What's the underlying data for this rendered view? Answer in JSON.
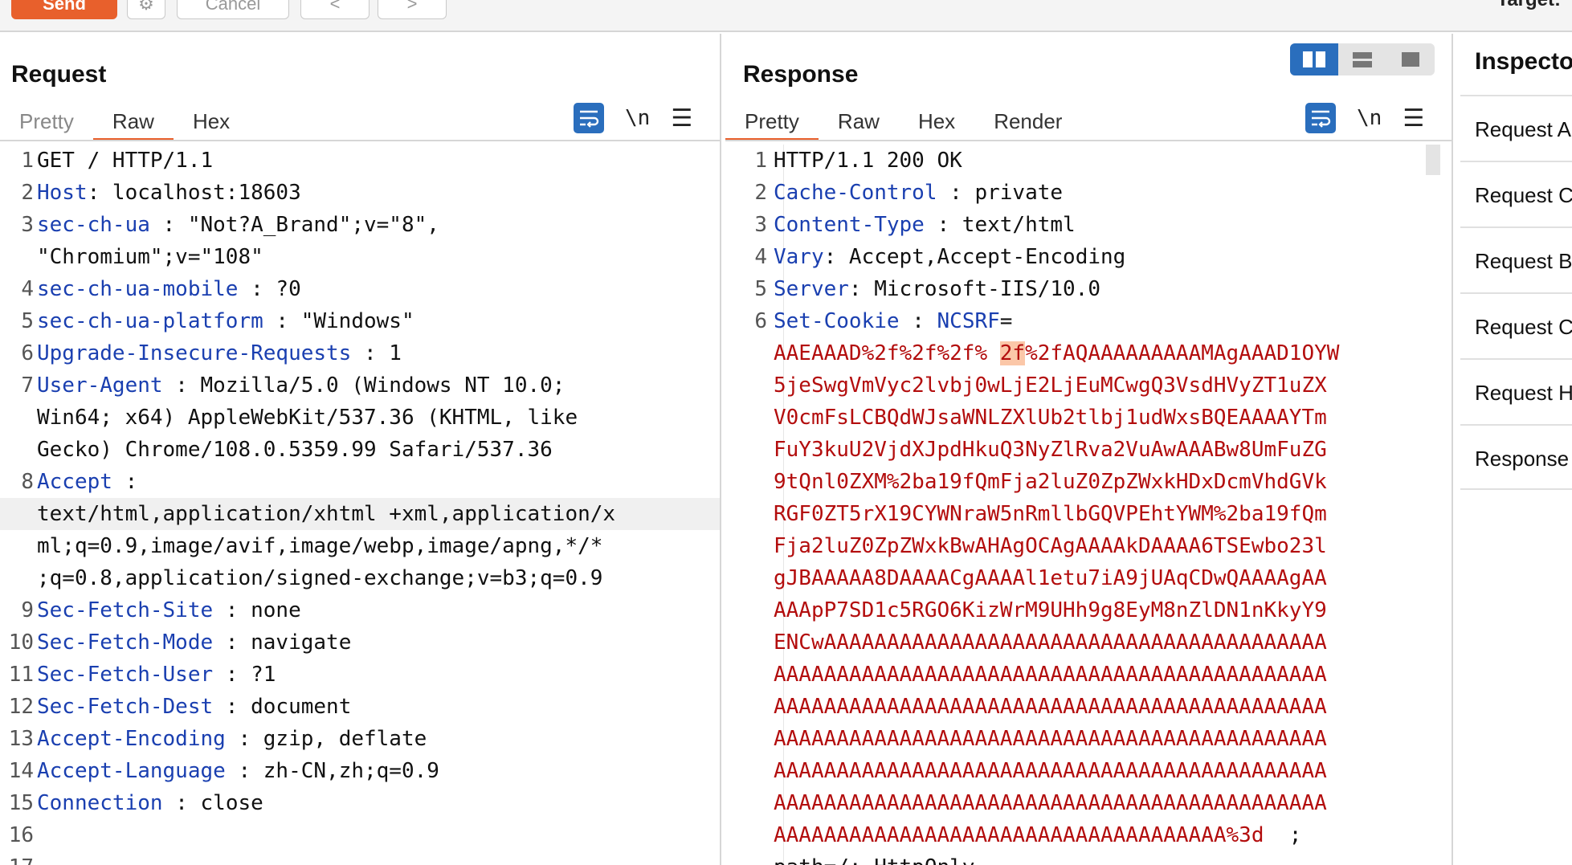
{
  "toolbar": {
    "send_label": "Send",
    "cancel_label": "Cancel",
    "back_label": "<",
    "forward_label": ">",
    "target_label": "Target:"
  },
  "request": {
    "title": "Request",
    "tabs": [
      "Pretty",
      "Raw",
      "Hex"
    ],
    "active_tab": "Raw"
  },
  "response": {
    "title": "Response",
    "tabs": [
      "Pretty",
      "Raw",
      "Hex",
      "Render"
    ],
    "active_tab": "Pretty"
  },
  "inspector": {
    "title": "Inspector",
    "items": [
      "Request A",
      "Request C",
      "Request B",
      "Request C",
      "Request H",
      "Response"
    ]
  },
  "request_lines": [
    {
      "n": "1",
      "parts": [
        [
          "t",
          "GET / HTTP/1.1"
        ]
      ]
    },
    {
      "n": "2",
      "parts": [
        [
          "k",
          "Host"
        ],
        [
          "t",
          ": localhost:18603"
        ]
      ]
    },
    {
      "n": "3",
      "parts": [
        [
          "k",
          "sec-ch-ua"
        ],
        [
          "t",
          " : \"Not?A_Brand\";v=\"8\","
        ]
      ]
    },
    {
      "n": "",
      "parts": [
        [
          "t",
          "\"Chromium\";v=\"108\""
        ]
      ]
    },
    {
      "n": "4",
      "parts": [
        [
          "k",
          "sec-ch-ua-mobile"
        ],
        [
          "t",
          " : ?0"
        ]
      ]
    },
    {
      "n": "5",
      "parts": [
        [
          "k",
          "sec-ch-ua-platform"
        ],
        [
          "t",
          " : \"Windows\""
        ]
      ]
    },
    {
      "n": "6",
      "parts": [
        [
          "k",
          "Upgrade-Insecure-Requests"
        ],
        [
          "t",
          " : 1"
        ]
      ]
    },
    {
      "n": "7",
      "parts": [
        [
          "k",
          "User-Agent"
        ],
        [
          "t",
          " : Mozilla/5.0 (Windows NT 10.0;"
        ]
      ]
    },
    {
      "n": "",
      "parts": [
        [
          "t",
          "Win64; x64) AppleWebKit/537.36 (KHTML, like"
        ]
      ]
    },
    {
      "n": "",
      "parts": [
        [
          "t",
          "Gecko) Chrome/108.0.5359.99 Safari/537.36"
        ]
      ]
    },
    {
      "n": "8",
      "parts": [
        [
          "k",
          "Accept"
        ],
        [
          "t",
          " :"
        ]
      ]
    },
    {
      "n": "",
      "cur": true,
      "parts": [
        [
          "t",
          "text/html,application/xhtml +xml,application/x"
        ]
      ]
    },
    {
      "n": "",
      "parts": [
        [
          "t",
          "ml;q=0.9,image/avif,image/webp,image/apng,*/*"
        ]
      ]
    },
    {
      "n": "",
      "parts": [
        [
          "t",
          ";q=0.8,application/signed-exchange;v=b3;q=0.9"
        ]
      ]
    },
    {
      "n": "9",
      "parts": [
        [
          "k",
          "Sec-Fetch-Site"
        ],
        [
          "t",
          " : none"
        ]
      ]
    },
    {
      "n": "10",
      "parts": [
        [
          "k",
          "Sec-Fetch-Mode"
        ],
        [
          "t",
          " : navigate"
        ]
      ]
    },
    {
      "n": "11",
      "parts": [
        [
          "k",
          "Sec-Fetch-User"
        ],
        [
          "t",
          " : ?1"
        ]
      ]
    },
    {
      "n": "12",
      "parts": [
        [
          "k",
          "Sec-Fetch-Dest"
        ],
        [
          "t",
          " : document"
        ]
      ]
    },
    {
      "n": "13",
      "parts": [
        [
          "k",
          "Accept-Encoding"
        ],
        [
          "t",
          " : gzip, deflate"
        ]
      ]
    },
    {
      "n": "14",
      "parts": [
        [
          "k",
          "Accept-Language"
        ],
        [
          "t",
          " : zh-CN,zh;q=0.9"
        ]
      ]
    },
    {
      "n": "15",
      "parts": [
        [
          "k",
          "Connection"
        ],
        [
          "t",
          " : close"
        ]
      ]
    },
    {
      "n": "16",
      "parts": [
        [
          "t",
          ""
        ]
      ]
    },
    {
      "n": "17",
      "parts": [
        [
          "t",
          ""
        ]
      ]
    }
  ],
  "response_lines": [
    {
      "n": "1",
      "parts": [
        [
          "t",
          "HTTP/1.1 200 OK"
        ]
      ]
    },
    {
      "n": "2",
      "parts": [
        [
          "k",
          "Cache-Control"
        ],
        [
          "t",
          " : private"
        ]
      ]
    },
    {
      "n": "3",
      "parts": [
        [
          "k",
          "Content-Type"
        ],
        [
          "t",
          " : text/html"
        ]
      ]
    },
    {
      "n": "4",
      "parts": [
        [
          "k",
          "Vary"
        ],
        [
          "t",
          ": Accept,Accept-Encoding"
        ]
      ]
    },
    {
      "n": "5",
      "parts": [
        [
          "k",
          "Server"
        ],
        [
          "t",
          ": Microsoft-IIS/10.0"
        ]
      ]
    },
    {
      "n": "6",
      "parts": [
        [
          "k",
          "Set-Cookie"
        ],
        [
          "t",
          " : "
        ],
        [
          "k",
          "NCSRF"
        ],
        [
          "t",
          "="
        ]
      ]
    },
    {
      "n": "",
      "parts": [
        [
          "r",
          "AAEAAAD%2f%2f%2f% "
        ],
        [
          "h",
          "2f"
        ],
        [
          "r",
          "%2fAQAAAAAAAAAMAgAAAD1OYW"
        ]
      ]
    },
    {
      "n": "",
      "parts": [
        [
          "r",
          "5jeSwgVmVyc2lvbj0wLjE2LjEuMCwgQ3VsdHVyZT1uZX"
        ]
      ]
    },
    {
      "n": "",
      "parts": [
        [
          "r",
          "V0cmFsLCBQdWJsaWNLZXlUb2tlbj1udWxsBQEAAAAYTm"
        ]
      ]
    },
    {
      "n": "",
      "parts": [
        [
          "r",
          "FuY3kuU2VjdXJpdHkuQ3NyZlRva2VuAwAAABw8UmFuZG"
        ]
      ]
    },
    {
      "n": "",
      "parts": [
        [
          "r",
          "9tQnl0ZXM%2ba19fQmFja2luZ0ZpZWxkHDxDcmVhdGVk"
        ]
      ]
    },
    {
      "n": "",
      "parts": [
        [
          "r",
          "RGF0ZT5rX19CYWNraW5nRmllbGQVPEhtYWM%2ba19fQm"
        ]
      ]
    },
    {
      "n": "",
      "parts": [
        [
          "r",
          "Fja2luZ0ZpZWxkBwAHAgOCAgAAAAkDAAAA6TSEwbo23l"
        ]
      ]
    },
    {
      "n": "",
      "parts": [
        [
          "r",
          "gJBAAAAA8DAAAACgAAAAl1etu7iA9jUAqCDwQAAAAgAA"
        ]
      ]
    },
    {
      "n": "",
      "parts": [
        [
          "r",
          "AAApP7SD1c5RGO6KizWrM9UHh9g8EyM8nZlDN1nKkyY9"
        ]
      ]
    },
    {
      "n": "",
      "parts": [
        [
          "r",
          "ENCwAAAAAAAAAAAAAAAAAAAAAAAAAAAAAAAAAAAAAAAA"
        ]
      ]
    },
    {
      "n": "",
      "parts": [
        [
          "r",
          "AAAAAAAAAAAAAAAAAAAAAAAAAAAAAAAAAAAAAAAAAAAA"
        ]
      ]
    },
    {
      "n": "",
      "parts": [
        [
          "r",
          "AAAAAAAAAAAAAAAAAAAAAAAAAAAAAAAAAAAAAAAAAAAA"
        ]
      ]
    },
    {
      "n": "",
      "parts": [
        [
          "r",
          "AAAAAAAAAAAAAAAAAAAAAAAAAAAAAAAAAAAAAAAAAAAA"
        ]
      ]
    },
    {
      "n": "",
      "parts": [
        [
          "r",
          "AAAAAAAAAAAAAAAAAAAAAAAAAAAAAAAAAAAAAAAAAAAA"
        ]
      ]
    },
    {
      "n": "",
      "parts": [
        [
          "r",
          "AAAAAAAAAAAAAAAAAAAAAAAAAAAAAAAAAAAAAAAAAAAA"
        ]
      ]
    },
    {
      "n": "",
      "parts": [
        [
          "r",
          "AAAAAAAAAAAAAAAAAAAAAAAAAAAAAAAAAAAA%3d"
        ],
        [
          "t",
          "  ;"
        ]
      ]
    },
    {
      "n": "",
      "parts": [
        [
          "t",
          "path=/; HttpOnly"
        ]
      ]
    }
  ]
}
